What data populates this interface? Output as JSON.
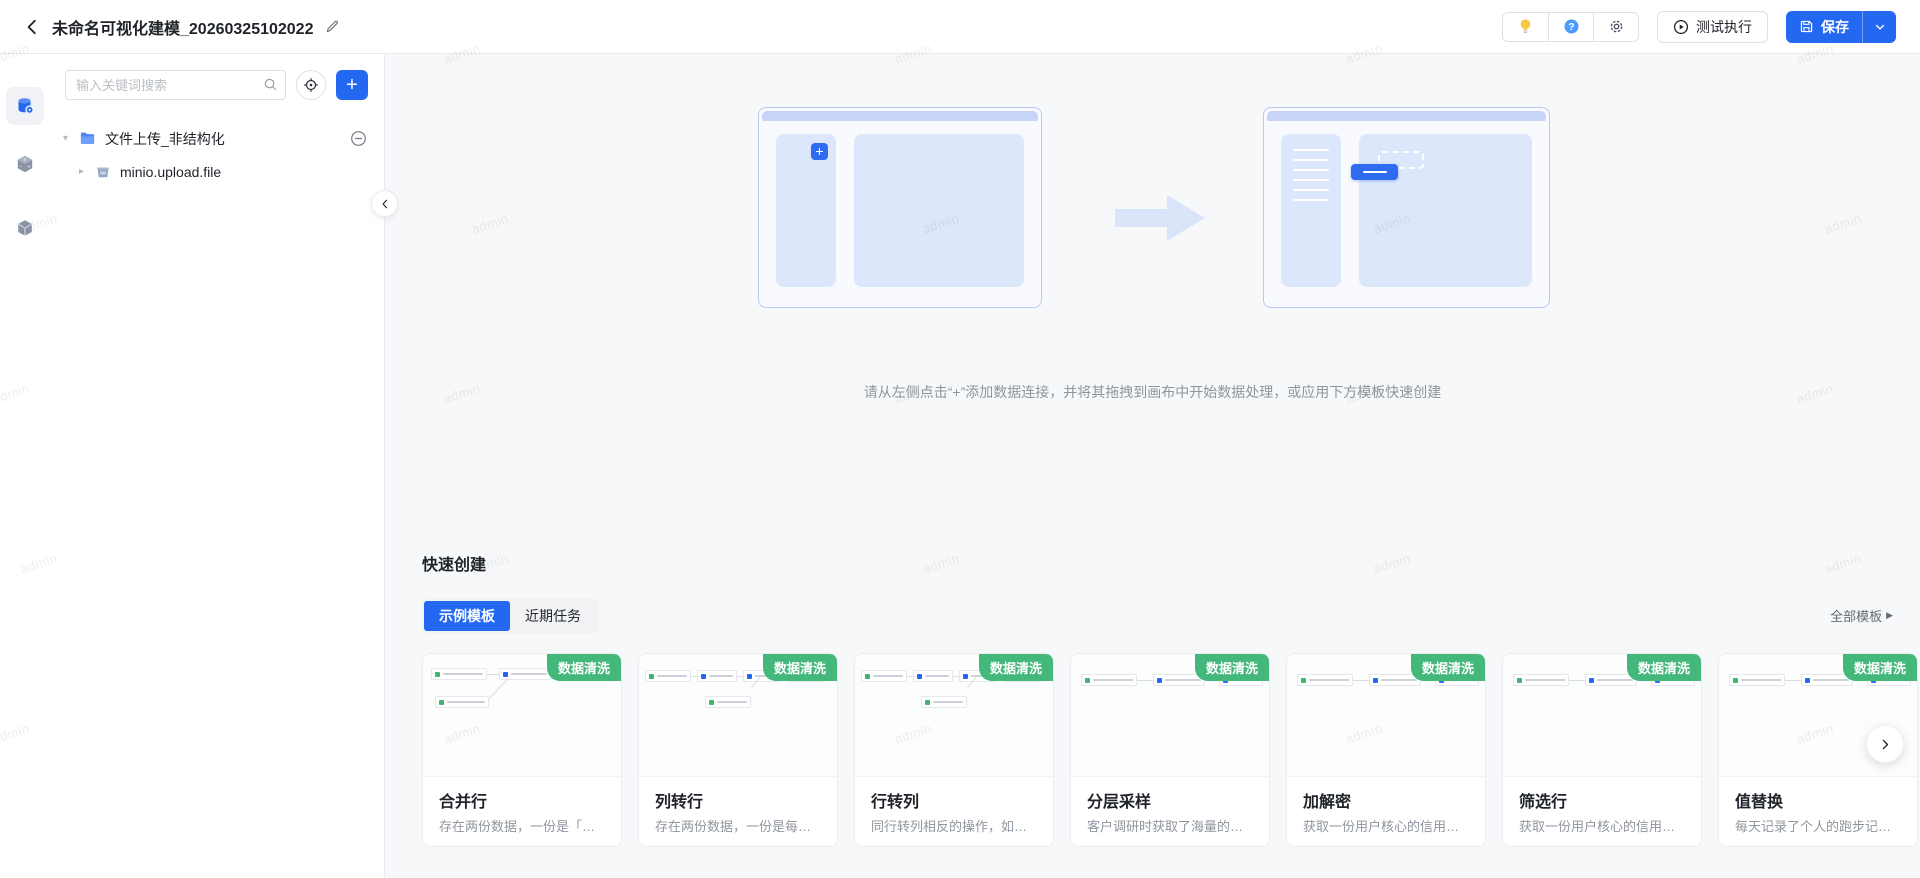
{
  "colors": {
    "accent": "#2468f2",
    "badge_green": "#43b87a",
    "canvas_bg": "#f7f8fa"
  },
  "watermark_text": "admin",
  "header": {
    "title": "未命名可视化建模_20260325102022",
    "icons": [
      "back-icon",
      "edit-pencil-icon",
      "lightbulb-icon",
      "help-icon",
      "gear-icon"
    ],
    "test_run_label": "测试执行",
    "save_label": "保存"
  },
  "sidebar_icons": [
    "data-source-icon",
    "operator-cube-icon",
    "model-cube-icon"
  ],
  "left_panel": {
    "search_placeholder": "输入关键词搜索",
    "tree": [
      {
        "label": "文件上传_非结构化",
        "icon": "folder-icon",
        "caret": "down",
        "indent": 0,
        "has_remove": true
      },
      {
        "label": "minio.upload.file",
        "icon": "bucket-icon",
        "caret": "right",
        "indent": 1,
        "has_remove": false
      }
    ]
  },
  "canvas": {
    "hint": "请从左侧点击“+”添加数据连接，并将其拖拽到画布中开始数据处理，或应用下方模板快速创建"
  },
  "quick_create": {
    "title": "快速创建",
    "tabs": [
      {
        "label": "示例模板",
        "active": true
      },
      {
        "label": "近期任务",
        "active": false
      }
    ],
    "all_templates_label": "全部模板",
    "cards": [
      {
        "badge": "数据清洗",
        "title": "合并行",
        "description": "存在两份数据，一份是「…",
        "thumb": "merge"
      },
      {
        "badge": "数据清洗",
        "title": "列转行",
        "description": "存在两份数据，一份是每…",
        "thumb": "branch"
      },
      {
        "badge": "数据清洗",
        "title": "行转列",
        "description": "同行转列相反的操作，如…",
        "thumb": "branch"
      },
      {
        "badge": "数据清洗",
        "title": "分层采样",
        "description": "客户调研时获取了海量的…",
        "thumb": "chain"
      },
      {
        "badge": "数据清洗",
        "title": "加解密",
        "description": "获取一份用户核心的信用…",
        "thumb": "chain"
      },
      {
        "badge": "数据清洗",
        "title": "筛选行",
        "description": "获取一份用户核心的信用…",
        "thumb": "chain"
      },
      {
        "badge": "数据清洗",
        "title": "值替换",
        "description": "每天记录了个人的跑步记…",
        "thumb": "chain"
      }
    ]
  }
}
